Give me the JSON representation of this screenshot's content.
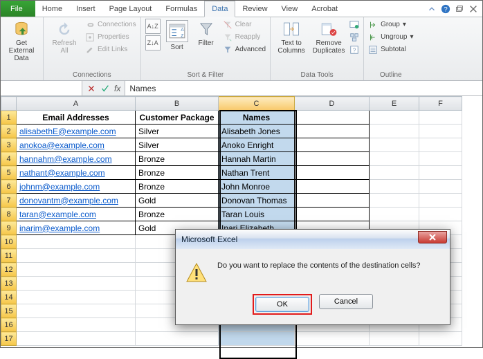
{
  "tabs": {
    "file": "File",
    "home": "Home",
    "insert": "Insert",
    "pageLayout": "Page Layout",
    "formulas": "Formulas",
    "data": "Data",
    "review": "Review",
    "view": "View",
    "acrobat": "Acrobat"
  },
  "ribbon": {
    "getExternal": "Get External Data",
    "refreshAll": "Refresh All",
    "connections": "Connections",
    "properties": "Properties",
    "editLinks": "Edit Links",
    "connGroup": "Connections",
    "sort": "Sort",
    "filter": "Filter",
    "clear": "Clear",
    "reapply": "Reapply",
    "advanced": "Advanced",
    "sortFilterGroup": "Sort & Filter",
    "textToColumns": "Text to Columns",
    "removeDuplicates": "Remove Duplicates",
    "dataToolsGroup": "Data Tools",
    "group": "Group",
    "ungroup": "Ungroup",
    "subtotal": "Subtotal",
    "outlineGroup": "Outline"
  },
  "formulaBar": {
    "name": "",
    "fx": "fx",
    "value": "Names"
  },
  "columns": [
    "A",
    "B",
    "C",
    "D",
    "E",
    "F"
  ],
  "headers": {
    "a": "Email Addresses",
    "b": "Customer Package",
    "c": "Names"
  },
  "rows": [
    {
      "a": "alisabethE@example.com",
      "b": "Silver",
      "c": "Alisabeth Jones"
    },
    {
      "a": "anokoa@example.com",
      "b": "Silver",
      "c": "Anoko Enright"
    },
    {
      "a": "hannahm@example.com",
      "b": "Bronze",
      "c": "Hannah Martin"
    },
    {
      "a": "nathant@example.com",
      "b": "Bronze",
      "c": "Nathan Trent"
    },
    {
      "a": "johnm@example.com",
      "b": "Bronze",
      "c": "John Monroe"
    },
    {
      "a": "donovantm@example.com",
      "b": "Gold",
      "c": "Donovan Thomas"
    },
    {
      "a": "taran@example.com",
      "b": "Bronze",
      "c": "Taran Louis"
    },
    {
      "a": "inarim@example.com",
      "b": "Gold",
      "c": "Inari Elizabeth"
    }
  ],
  "dialog": {
    "title": "Microsoft Excel",
    "message": "Do you want to replace the contents of the destination cells?",
    "ok": "OK",
    "cancel": "Cancel"
  }
}
